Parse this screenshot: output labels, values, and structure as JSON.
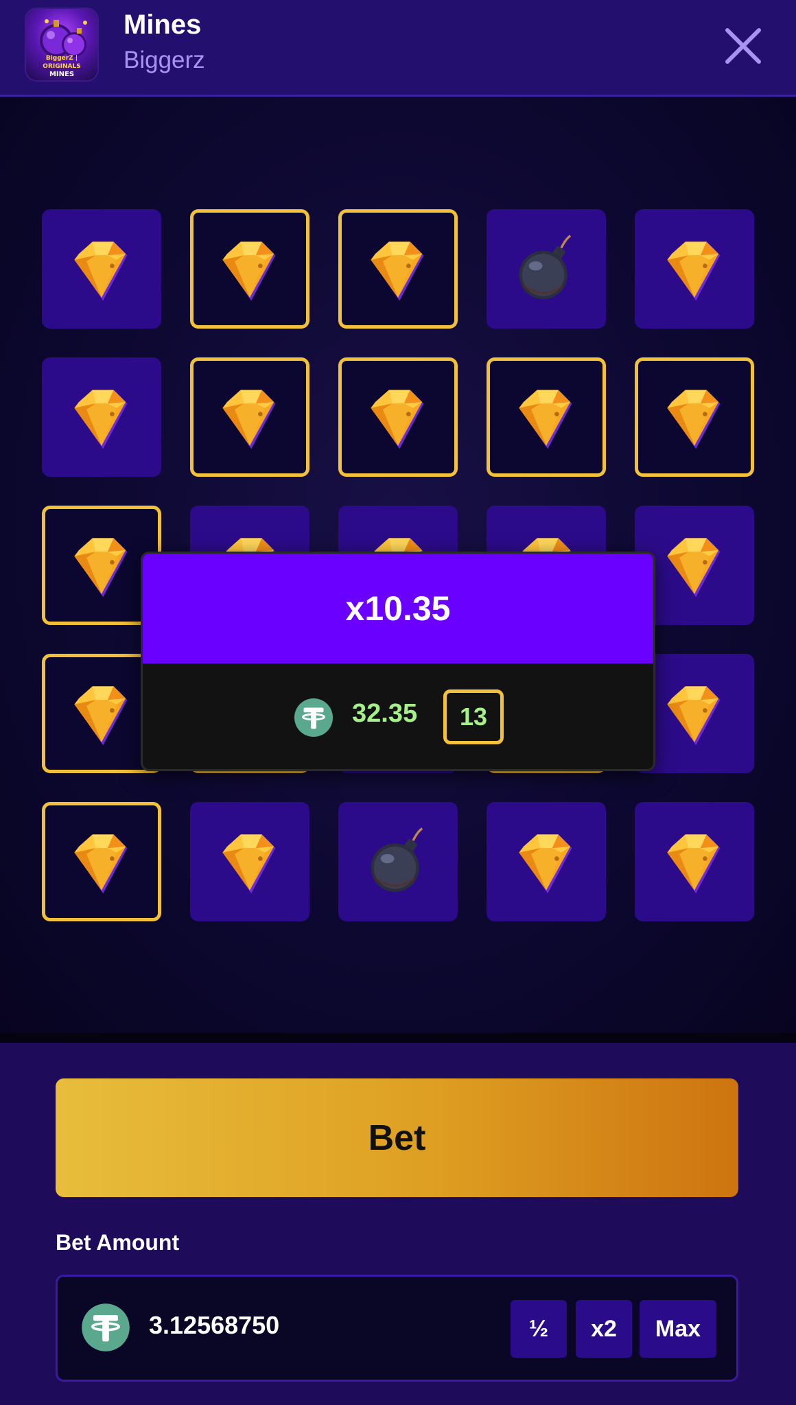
{
  "header": {
    "title": "Mines",
    "subtitle": "Biggerz",
    "icon_caption_top": "BiggerZ | ORIGINALS",
    "icon_caption_bottom": "MINES"
  },
  "grid": {
    "rows": 5,
    "columns": 5,
    "tiles": [
      {
        "content": "gem",
        "picked": false
      },
      {
        "content": "gem",
        "picked": true
      },
      {
        "content": "gem",
        "picked": true
      },
      {
        "content": "mine",
        "picked": false
      },
      {
        "content": "gem",
        "picked": false
      },
      {
        "content": "gem",
        "picked": false
      },
      {
        "content": "gem",
        "picked": true
      },
      {
        "content": "gem",
        "picked": true
      },
      {
        "content": "gem",
        "picked": true
      },
      {
        "content": "gem",
        "picked": true
      },
      {
        "content": "gem",
        "picked": true
      },
      {
        "content": "gem",
        "picked": false
      },
      {
        "content": "gem",
        "picked": false
      },
      {
        "content": "gem",
        "picked": false
      },
      {
        "content": "gem",
        "picked": false
      },
      {
        "content": "gem",
        "picked": true
      },
      {
        "content": "gem",
        "picked": true
      },
      {
        "content": "mine",
        "picked": false
      },
      {
        "content": "gem",
        "picked": true
      },
      {
        "content": "gem",
        "picked": false
      },
      {
        "content": "gem",
        "picked": true
      },
      {
        "content": "gem",
        "picked": false
      },
      {
        "content": "mine",
        "picked": false
      },
      {
        "content": "gem",
        "picked": false
      },
      {
        "content": "gem",
        "picked": false
      }
    ]
  },
  "result": {
    "multiplier": "x10.35",
    "payout": "32.35",
    "gems_found": "13",
    "currency_icon": "tether-icon"
  },
  "controls": {
    "bet_label": "Bet",
    "bet_amount_label": "Bet Amount",
    "bet_amount_value": "3.12568750",
    "half_label": "½",
    "double_label": "x2",
    "max_label": "Max"
  },
  "colors": {
    "header_bg": "#230f6e",
    "tile_unpicked": "#2c0b8a",
    "tile_picked_border": "#f2c13a",
    "popup_accent": "#6a00ff",
    "payout_green": "#a6f08a",
    "coin_teal": "#5aa98f"
  }
}
